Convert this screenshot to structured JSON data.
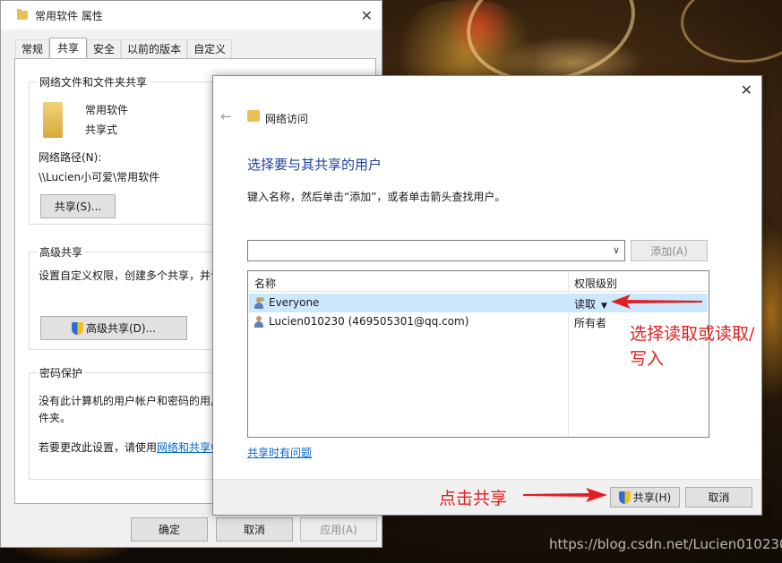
{
  "props_window": {
    "title": "常用软件 属性",
    "tabs": [
      {
        "label": "常规"
      },
      {
        "label": "共享"
      },
      {
        "label": "安全"
      },
      {
        "label": "以前的版本"
      },
      {
        "label": "自定义"
      }
    ],
    "net_share_group": {
      "label": "网络文件和文件夹共享",
      "folder_name": "常用软件",
      "folder_state": "共享式",
      "path_label": "网络路径(N):",
      "path_value": "\\\\Lucien小可爱\\常用软件",
      "share_button": "共享(S)..."
    },
    "advanced_group": {
      "label": "高级共享",
      "description": "设置自定义权限，创建多个共享，并设",
      "button": "高级共享(D)..."
    },
    "password_group": {
      "label": "密码保护",
      "line1": "没有此计算机的用户帐户和密码的用户",
      "line2": "件夹。",
      "line3_prefix": "若要更改此设置，请使用",
      "line3_link": "网络和共享中"
    },
    "buttons": {
      "ok": "确定",
      "cancel": "取消",
      "apply": "应用(A)"
    }
  },
  "net_dialog": {
    "title": "网络访问",
    "heading": "选择要与其共享的用户",
    "instruction": "键入名称，然后单击“添加”，或者单击箭头查找用户。",
    "name_input_value": "",
    "add_button": "添加(A)",
    "columns": [
      "名称",
      "权限级别"
    ],
    "rows": [
      {
        "name": "Everyone",
        "permission": "读取",
        "selected": true
      },
      {
        "name": "Lucien010230 (469505301@qq.com)",
        "permission": "所有者",
        "selected": false
      }
    ],
    "trouble_link": "共享时有问题",
    "share_button": "共享(H)",
    "cancel_button": "取消"
  },
  "annotations": {
    "permission_note_line1": "选择读取或读取/",
    "permission_note_line2": "写入",
    "share_note": "点击共享",
    "color": "#e02020"
  },
  "watermark": "https://blog.csdn.net/Lucien010230"
}
